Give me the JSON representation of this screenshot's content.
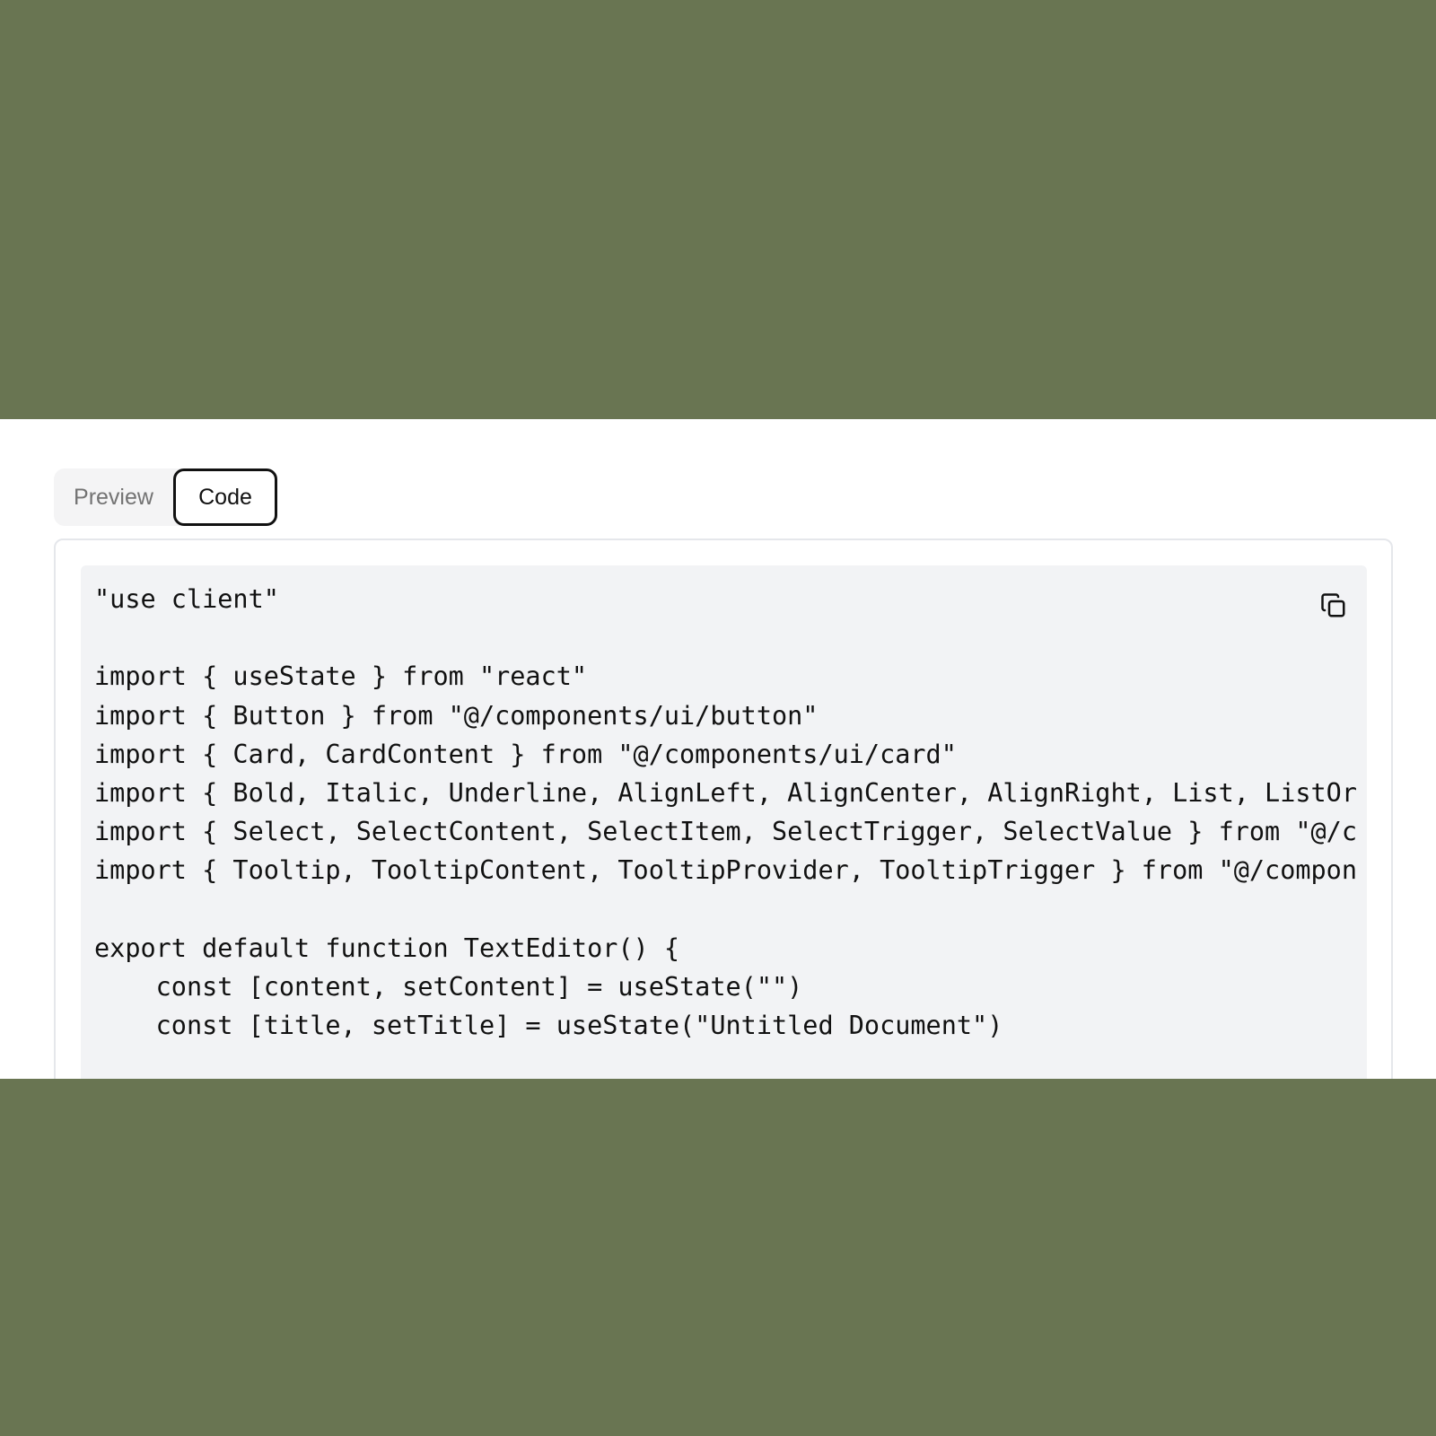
{
  "tabs": {
    "preview_label": "Preview",
    "code_label": "Code",
    "active": "Code"
  },
  "code": {
    "lines": [
      "\"use client\"",
      "",
      "import { useState } from \"react\"",
      "import { Button } from \"@/components/ui/button\"",
      "import { Card, CardContent } from \"@/components/ui/card\"",
      "import { Bold, Italic, Underline, AlignLeft, AlignCenter, AlignRight, List, ListOr",
      "import { Select, SelectContent, SelectItem, SelectTrigger, SelectValue } from \"@/c",
      "import { Tooltip, TooltipContent, TooltipProvider, TooltipTrigger } from \"@/compon",
      "",
      "export default function TextEditor() {",
      "    const [content, setContent] = useState(\"\")",
      "    const [title, setTitle] = useState(\"Untitled Document\")"
    ]
  },
  "icons": {
    "copy": "copy-icon"
  },
  "colors": {
    "backdrop": "#697552",
    "panel": "#ffffff",
    "code_background": "#f2f3f5",
    "tab_bar": "#f4f4f5",
    "text": "#111111",
    "muted_text": "#737373"
  }
}
